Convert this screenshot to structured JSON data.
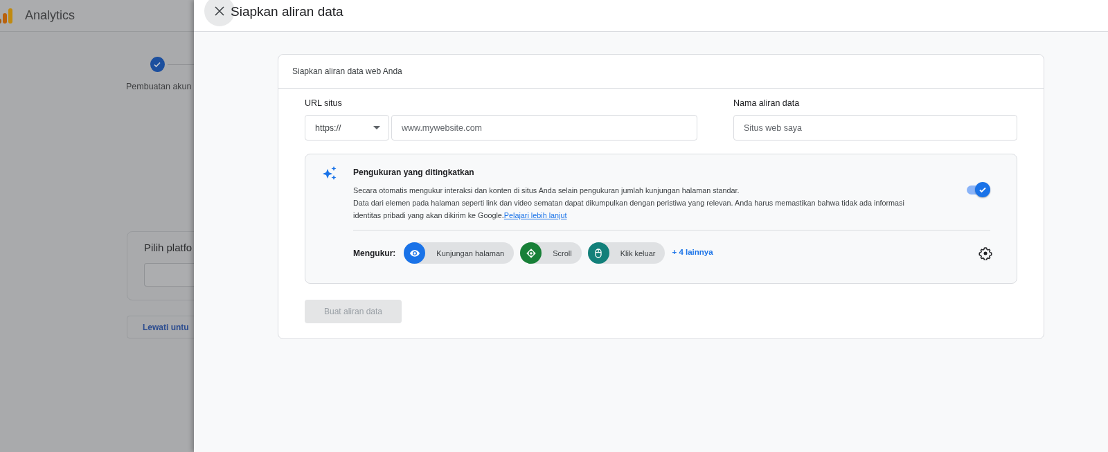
{
  "background": {
    "app_name": "Analytics",
    "steps": [
      {
        "label": "Pembuatan akun",
        "done": true
      }
    ],
    "platform_card": {
      "title": "Pilih platfo"
    },
    "skip_button": "Lewati untu"
  },
  "panel": {
    "title": "Siapkan aliran data",
    "card": {
      "title": "Siapkan aliran data web Anda",
      "url_label": "URL situs",
      "protocol": "https://",
      "url_placeholder": "www.mywebsite.com",
      "name_label": "Nama aliran data",
      "name_placeholder": "Situs web saya",
      "enhanced": {
        "title": "Pengukuran yang ditingkatkan",
        "on": true,
        "description": [
          "Secara otomatis mengukur interaksi dan konten di situs Anda selain pengukuran jumlah kunjungan halaman standar.",
          "Data dari elemen pada halaman seperti link dan video sematan dapat dikumpulkan dengan peristiwa yang relevan. Anda harus memastikan bahwa tidak ada informasi identitas pribadi yang akan dikirim ke Google."
        ],
        "link": "Pelajari lebih lanjut",
        "measures_label": "Mengukur:",
        "measures": [
          {
            "label": "Kunjungan halaman",
            "kind": "eye",
            "color": "#1a73e8"
          },
          {
            "label": "Scroll",
            "kind": "scroll",
            "color": "#188038"
          },
          {
            "label": "Klik keluar",
            "kind": "mouse",
            "color": "#12807a"
          }
        ],
        "more": "+ 4 lainnya"
      },
      "create_button": {
        "label": "Buat aliran data",
        "disabled": true
      }
    }
  }
}
